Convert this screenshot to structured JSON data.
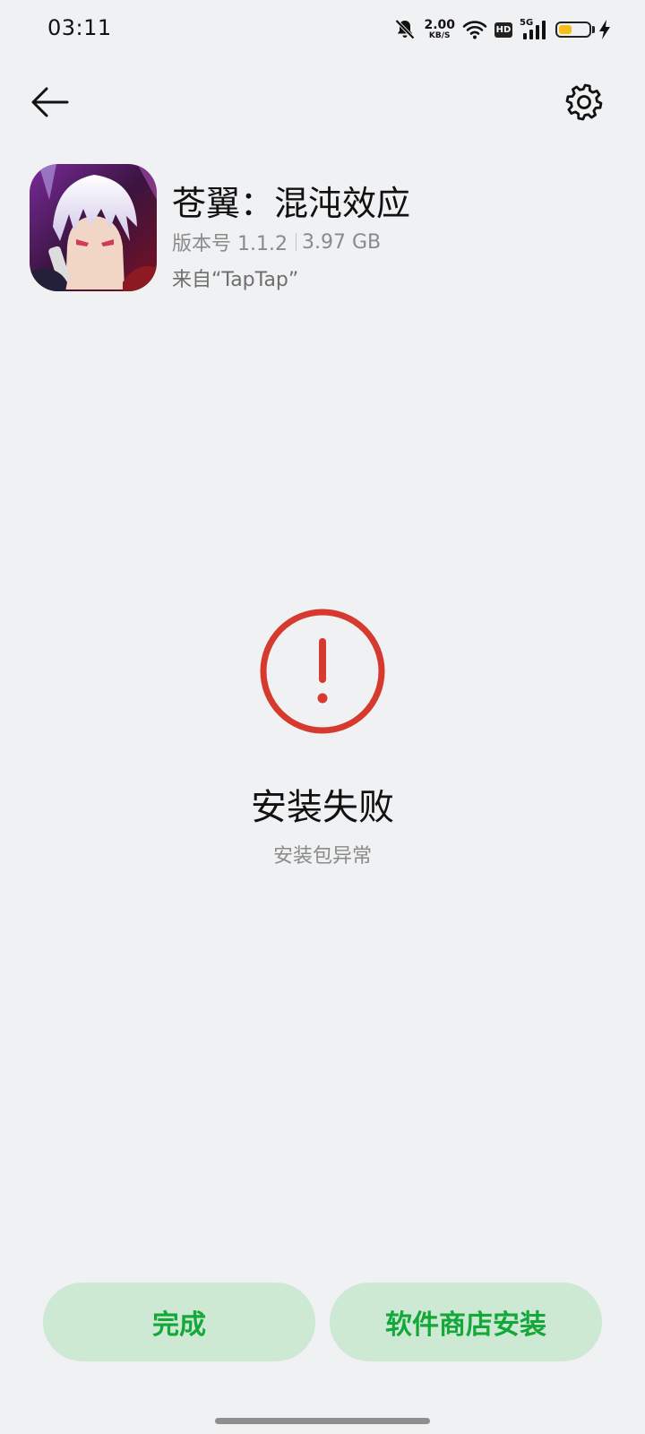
{
  "status_bar": {
    "time": "03:11",
    "net_speed_value": "2.00",
    "net_speed_unit": "KB/S",
    "hd_label": "HD",
    "network_type": "5G",
    "battery_level_percent": 45,
    "icons": [
      "mute-bell-icon",
      "wifi-icon",
      "hd-icon",
      "signal-icon",
      "battery-icon",
      "charging-bolt-icon"
    ]
  },
  "toolbar": {
    "back_icon": "back-arrow-icon",
    "settings_icon": "gear-icon"
  },
  "app": {
    "name": "苍翼：混沌效应",
    "version": "版本号 1.1.2",
    "size": "3.97 GB",
    "source": "来自“TapTap”"
  },
  "result": {
    "icon": "error-circle-icon",
    "color": "#d63a2f",
    "title": "安装失败",
    "subtitle": "安装包异常"
  },
  "buttons": {
    "done_label": "完成",
    "store_install_label": "软件商店安装",
    "bg_color": "#cde9d3",
    "text_color": "#14a83a"
  }
}
